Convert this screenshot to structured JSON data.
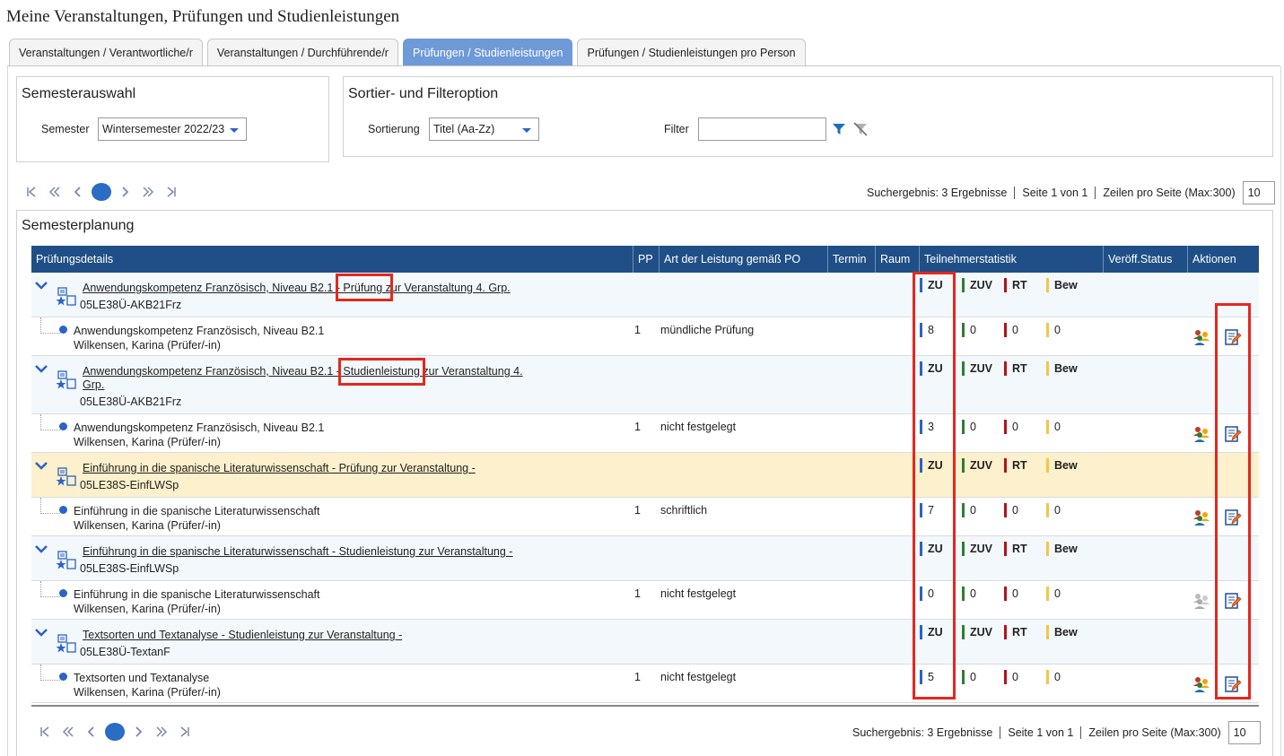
{
  "page_title": "Meine Veranstaltungen, Prüfungen und Studienleistungen",
  "tabs": [
    {
      "label": "Veranstaltungen / Verantwortliche/r",
      "active": false
    },
    {
      "label": "Veranstaltungen / Durchführende/r",
      "active": false
    },
    {
      "label": "Prüfungen / Studienleistungen",
      "active": true
    },
    {
      "label": "Prüfungen / Studienleistungen pro Person",
      "active": false
    }
  ],
  "semester_panel": {
    "title": "Semesterauswahl",
    "semester_label": "Semester",
    "semester_value": "Wintersemester 2022/23"
  },
  "filter_panel": {
    "title": "Sortier- und Filteroption",
    "sort_label": "Sortierung",
    "sort_value": "Titel (Aa-Zz)",
    "filter_label": "Filter",
    "filter_value": ""
  },
  "pagination": {
    "results": "Suchergebnis: 3 Ergebnisse",
    "page": "Seite 1 von 1",
    "rows_label": "Zeilen pro Seite (Max:300)",
    "rows_value": "10"
  },
  "section_title": "Semesterplanung",
  "columns": {
    "details": "Prüfungsdetails",
    "pp": "PP",
    "art": "Art der Leistung gemäß PO",
    "termin": "Termin",
    "raum": "Raum",
    "stats": "Teilnehmerstatistik",
    "status": "Veröff.Status",
    "actions": "Aktionen"
  },
  "stat_labels": {
    "zu": "ZU",
    "zuv": "ZUV",
    "rt": "RT",
    "bew": "Bew"
  },
  "stat_colors": {
    "zu": "#2b63c6",
    "zuv": "#2e7d32",
    "rt": "#b3121b",
    "bew": "#f2c744"
  },
  "highlight_color": "#e3281f",
  "entries": [
    {
      "title": "Anwendungskompetenz Französisch, Niveau B2.1 - Prüfung zur Veranstaltung 4. Grp.",
      "code": "05LE38Ü-AKB21Frz",
      "highlighted": false,
      "sub": {
        "name": "Anwendungskompetenz Französisch, Niveau B2.1",
        "examiner": "Wilkensen, Karina (Prüfer/-in)",
        "pp": "1",
        "art": "mündliche Prüfung",
        "zu": "8",
        "zuv": "0",
        "rt": "0",
        "bew": "0",
        "people_active": true
      }
    },
    {
      "title": "Anwendungskompetenz Französisch, Niveau B2.1 - Studienleistung zur Veranstaltung 4. Grp.",
      "code": "05LE38Ü-AKB21Frz",
      "highlighted": false,
      "sub": {
        "name": "Anwendungskompetenz Französisch, Niveau B2.1",
        "examiner": "Wilkensen, Karina (Prüfer/-in)",
        "pp": "1",
        "art": "nicht festgelegt",
        "zu": "3",
        "zuv": "0",
        "rt": "0",
        "bew": "0",
        "people_active": true
      }
    },
    {
      "title": "Einführung in die spanische Literaturwissenschaft - Prüfung zur Veranstaltung -",
      "code": "05LE38S-EinfLWSp",
      "highlighted": true,
      "sub": {
        "name": "Einführung in die spanische Literaturwissenschaft",
        "examiner": "Wilkensen, Karina (Prüfer/-in)",
        "pp": "1",
        "art": "schriftlich",
        "zu": "7",
        "zuv": "0",
        "rt": "0",
        "bew": "0",
        "people_active": true
      }
    },
    {
      "title": "Einführung in die spanische Literaturwissenschaft - Studienleistung zur Veranstaltung -",
      "code": "05LE38S-EinfLWSp",
      "highlighted": false,
      "sub": {
        "name": "Einführung in die spanische Literaturwissenschaft",
        "examiner": "Wilkensen, Karina (Prüfer/-in)",
        "pp": "1",
        "art": "nicht festgelegt",
        "zu": "0",
        "zuv": "0",
        "rt": "0",
        "bew": "0",
        "people_active": false
      }
    },
    {
      "title": "Textsorten und Textanalyse - Studienleistung zur Veranstaltung -",
      "code": "05LE38Ü-TextanF",
      "highlighted": false,
      "sub": {
        "name": "Textsorten und Textanalyse",
        "examiner": "Wilkensen, Karina (Prüfer/-in)",
        "pp": "1",
        "art": "nicht festgelegt",
        "zu": "5",
        "zuv": "0",
        "rt": "0",
        "bew": "0",
        "people_active": true
      }
    }
  ]
}
